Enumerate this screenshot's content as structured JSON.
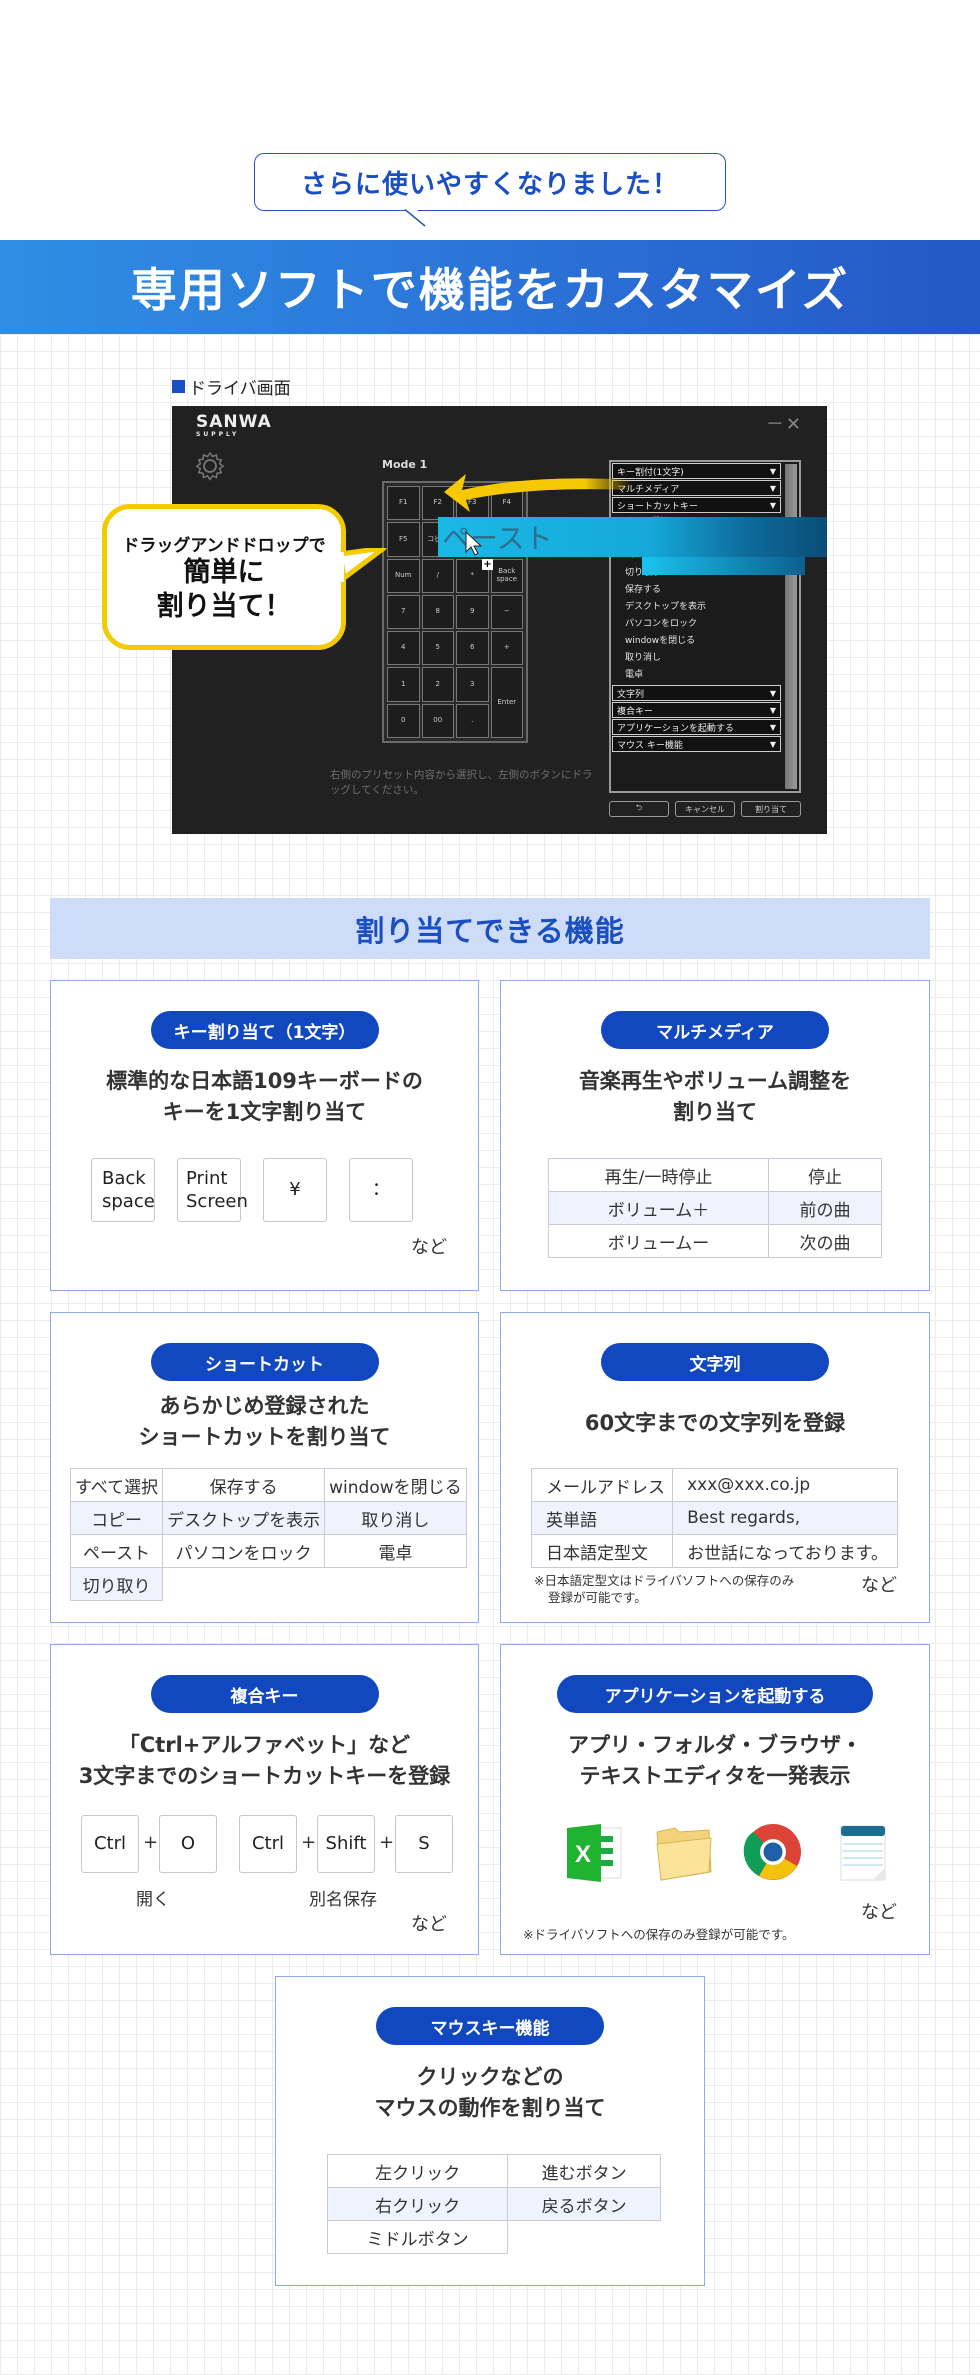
{
  "header": {
    "callout": "さらに使いやすくなりました！",
    "banner_title": "専用ソフトで機能をカスタマイズ"
  },
  "driver": {
    "section_label": "ドライバ画面",
    "logo": "SANWA",
    "logo_sub": "SUPPLY",
    "window_controls": "－✕",
    "mode_label": "Mode 1",
    "keypad_keys": [
      "F1",
      "F2",
      "F3",
      "F4",
      "F5",
      "コピー",
      "",
      "",
      "Num",
      "/",
      "*",
      "Back space",
      "7",
      "8",
      "9",
      "−",
      "4",
      "5",
      "6",
      "+",
      "1",
      "2",
      "3",
      "Enter",
      "0",
      "00",
      "."
    ],
    "hint": "右側のプリセット内容から選択し、左側のボタンにドラッグしてください。",
    "categories_top": [
      {
        "label": "キー割付(1文字)",
        "arrow": "▼"
      },
      {
        "label": "マルチメディア",
        "arrow": "▼"
      },
      {
        "label": "ショートカットキー",
        "arrow": "▼"
      }
    ],
    "shortcut_items": [
      "すべて選択",
      "コピー",
      "ペースト",
      "切り取り",
      "保存する",
      "デスクトップを表示",
      "パソコンをロック",
      "windowを閉じる",
      "取り消し",
      "電卓"
    ],
    "categories_bottom": [
      {
        "label": "文字列",
        "arrow": "▼"
      },
      {
        "label": "複合キー",
        "arrow": "▼"
      },
      {
        "label": "アプリケーションを起動する",
        "arrow": "▼"
      },
      {
        "label": "マウス キー機能",
        "arrow": "▼"
      }
    ],
    "buttons": {
      "undo": "⮌",
      "cancel": "キャンセル",
      "assign": "割り当て"
    },
    "drag_item": "ペースト",
    "bubble": {
      "line1": "ドラッグアンドドロップで",
      "line2": "簡単に",
      "line3": "割り当て！"
    }
  },
  "features": {
    "heading": "割り当てできる機能",
    "single_key": {
      "pill": "キー割り当て（1文字）",
      "title1": "標準的な日本語109キーボードの",
      "title2": "キーを1文字割り当て",
      "keys": [
        "Back\nspace",
        "Print\nScreen",
        "¥",
        "："
      ],
      "etc": "など"
    },
    "multimedia": {
      "pill": "マルチメディア",
      "title1": "音楽再生やボリューム調整を",
      "title2": "割り当て",
      "rows": [
        [
          "再生/一時停止",
          "停止"
        ],
        [
          "ボリューム＋",
          "前の曲"
        ],
        [
          "ボリュームー",
          "次の曲"
        ]
      ]
    },
    "shortcut": {
      "pill": "ショートカット",
      "title1": "あらかじめ登録された",
      "title2": "ショートカットを割り当て",
      "rows": [
        [
          "すべて選択",
          "保存する",
          "windowを閉じる"
        ],
        [
          "コピー",
          "デスクトップを表示",
          "取り消し"
        ],
        [
          "ペースト",
          "パソコンをロック",
          "電卓"
        ],
        [
          "切り取り",
          "",
          ""
        ]
      ]
    },
    "string": {
      "pill": "文字列",
      "title1": "60文字までの文字列を登録",
      "rows": [
        [
          "メールアドレス",
          "xxx@xxx.co.jp"
        ],
        [
          "英単語",
          "Best regards,"
        ],
        [
          "日本語定型文",
          "お世話になっております。"
        ]
      ],
      "note1": "※日本語定型文はドライバソフトへの保存のみ",
      "note2": "登録が可能です。",
      "etc": "など"
    },
    "combo": {
      "pill": "複合キー",
      "title1": "「Ctrl+アルファベット」など",
      "title2": "3文字までのショートカットキーを登録",
      "combo1": {
        "keys": [
          "Ctrl",
          "O"
        ],
        "caption": "開く"
      },
      "combo2": {
        "keys": [
          "Ctrl",
          "Shift",
          "S"
        ],
        "caption": "別名保存"
      },
      "plus": "+",
      "etc": "など"
    },
    "app": {
      "pill": "アプリケーションを起動する",
      "title1": "アプリ・フォルダ・ブラウザ・",
      "title2": "テキストエディタを一発表示",
      "icons": [
        "excel-icon",
        "folder-icon",
        "chrome-icon",
        "notepad-icon"
      ],
      "etc": "など",
      "note": "※ドライバソフトへの保存のみ登録が可能です。"
    },
    "mouse": {
      "pill": "マウスキー機能",
      "title1": "クリックなどの",
      "title2": "マウスの動作を割り当て",
      "rows": [
        [
          "左クリック",
          "進むボタン"
        ],
        [
          "右クリック",
          "戻るボタン"
        ],
        [
          "ミドルボタン",
          ""
        ]
      ]
    }
  },
  "colors": {
    "brand_blue": "#1248bf",
    "banner_start": "#2f8ee3",
    "banner_end": "#2457c6",
    "header_band": "#cfdcf7",
    "bubble_border": "#f2cb00",
    "drag_cyan": "#1bb8e6"
  }
}
